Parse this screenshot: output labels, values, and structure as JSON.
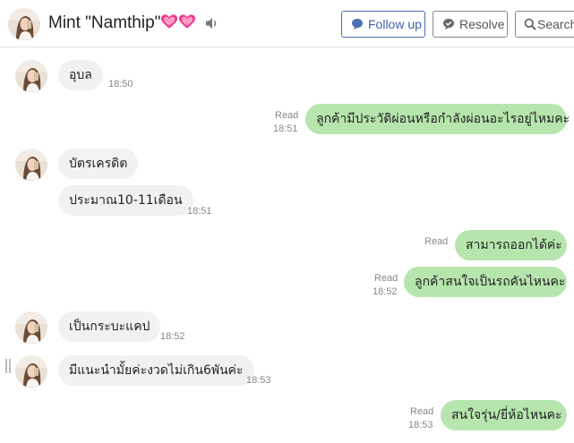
{
  "header": {
    "contact_name": "Mint \"Namthip\"",
    "follow_up_label": "Follow up",
    "resolve_label": "Resolve",
    "search_label": "Search"
  },
  "messages": [
    {
      "direction": "in",
      "text": "อุบล",
      "time": "18:50"
    },
    {
      "direction": "out",
      "text": "ลูกค้ามีประวัติผ่อนหรือกำลังผ่อนอะไรอยู่ไหมคะ",
      "status": "Read",
      "time": "18:51"
    },
    {
      "direction": "in",
      "text": "บัตรเครดิต",
      "time": ""
    },
    {
      "direction": "in",
      "text": "ประมาณ10-11เดือน",
      "time": "18:51"
    },
    {
      "direction": "out",
      "text": "สามารถออกได้ค่ะ",
      "status": "Read",
      "time": ""
    },
    {
      "direction": "out",
      "text": "ลูกค้าสนใจเป็นรถคันไหนคะ",
      "status": "Read",
      "time": "18:52"
    },
    {
      "direction": "in",
      "text": "เป็นกระบะแคป",
      "time": "18:52"
    },
    {
      "direction": "in",
      "text": "มีแนะนำมั้ยค่ะงวดไม่เกิน6พันค่ะ",
      "time": "18:53"
    },
    {
      "direction": "out",
      "text": "สนใจรุ่น/ยี่ห้อไหนคะ",
      "status": "Read",
      "time": "18:53"
    }
  ],
  "colors": {
    "incoming_bubble": "#f0f1f2",
    "outgoing_bubble": "#b6e6ad",
    "follow_up_accent": "#3f63a8"
  },
  "icons": [
    "avatar",
    "heart-icon",
    "speaker-icon",
    "chat-bubble-icon",
    "check-chat-icon",
    "search-icon"
  ]
}
